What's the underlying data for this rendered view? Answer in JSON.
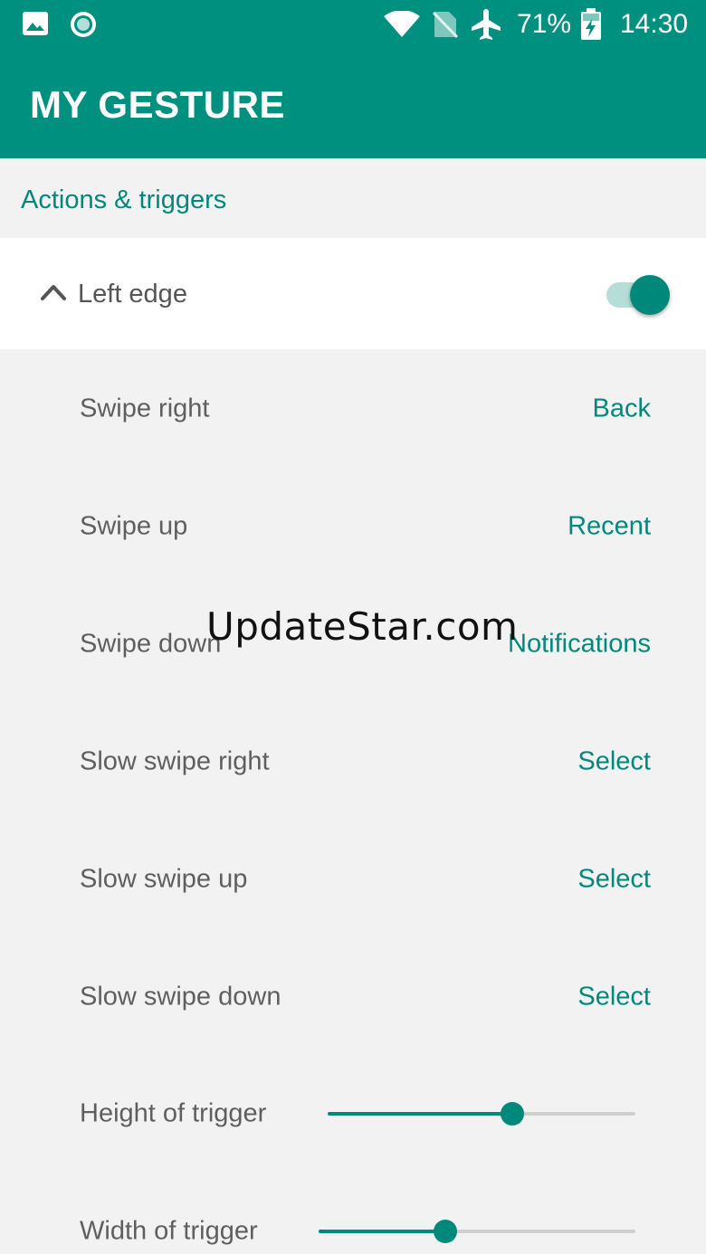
{
  "status_bar": {
    "battery": "71%",
    "time": "14:30",
    "icons": [
      "image-icon",
      "record-icon",
      "wifi-icon",
      "no-sim-icon",
      "airplane-icon",
      "battery-charging-icon"
    ]
  },
  "app_bar": {
    "title": "MY GESTURE"
  },
  "section": {
    "title": "Actions & triggers"
  },
  "group": {
    "label": "Left edge",
    "enabled": true
  },
  "actions": [
    {
      "label": "Swipe right",
      "value": "Back"
    },
    {
      "label": "Swipe up",
      "value": "Recent"
    },
    {
      "label": "Swipe down",
      "value": "Notifications"
    },
    {
      "label": "Slow swipe right",
      "value": "Select"
    },
    {
      "label": "Slow swipe up",
      "value": "Select"
    },
    {
      "label": "Slow swipe down",
      "value": "Select"
    }
  ],
  "sliders": [
    {
      "label": "Height of trigger",
      "value_fraction": 0.6
    },
    {
      "label": "Width of trigger",
      "value_fraction": 0.4
    }
  ],
  "watermark": "UpdateStar.com",
  "colors": {
    "primary": "#009080",
    "accent": "#00897b",
    "background": "#f2f2f2"
  }
}
